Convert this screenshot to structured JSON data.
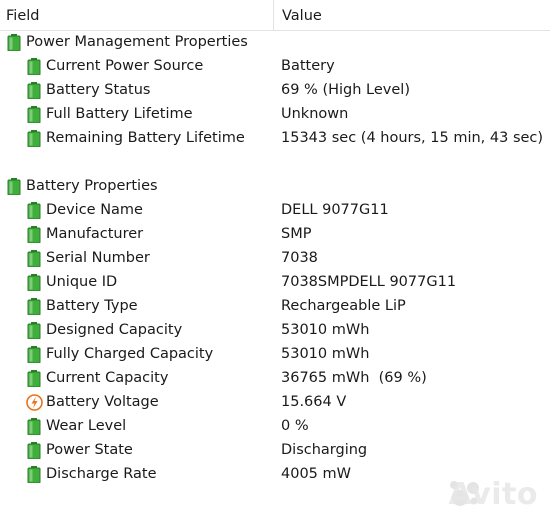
{
  "columns": {
    "field": "Field",
    "value": "Value"
  },
  "rows": [
    {
      "label": "Power Management Properties",
      "value": "",
      "icon": "battery-icon"
    },
    {
      "label": "Current Power Source",
      "value": "Battery",
      "icon": "battery-icon"
    },
    {
      "label": "Battery Status",
      "value": "69 % (High Level)",
      "icon": "battery-icon"
    },
    {
      "label": "Full Battery Lifetime",
      "value": "Unknown",
      "icon": "battery-icon"
    },
    {
      "label": "Remaining Battery Lifetime",
      "value": "15343 sec (4 hours, 15 min, 43 sec)",
      "icon": "battery-icon"
    },
    {
      "label": "Battery Properties",
      "value": "",
      "icon": "battery-icon"
    },
    {
      "label": "Device Name",
      "value": "DELL 9077G11",
      "icon": "battery-icon"
    },
    {
      "label": "Manufacturer",
      "value": "SMP",
      "icon": "battery-icon"
    },
    {
      "label": "Serial Number",
      "value": "7038",
      "icon": "battery-icon"
    },
    {
      "label": "Unique ID",
      "value": "7038SMPDELL 9077G11",
      "icon": "battery-icon"
    },
    {
      "label": "Battery Type",
      "value": "Rechargeable LiP",
      "icon": "battery-icon"
    },
    {
      "label": "Designed Capacity",
      "value": "53010 mWh",
      "icon": "battery-icon"
    },
    {
      "label": "Fully Charged Capacity",
      "value": "53010 mWh",
      "icon": "battery-icon"
    },
    {
      "label": "Current Capacity",
      "value": "36765 mWh  (69 %)",
      "icon": "battery-icon"
    },
    {
      "label": "Battery Voltage",
      "value": "15.664 V",
      "icon": "voltage-icon"
    },
    {
      "label": "Wear Level",
      "value": "0 %",
      "icon": "battery-icon"
    },
    {
      "label": "Power State",
      "value": "Discharging",
      "icon": "battery-icon"
    },
    {
      "label": "Discharge Rate",
      "value": "4005 mW",
      "icon": "battery-icon"
    }
  ],
  "watermark": "Avito",
  "colors": {
    "battery_green": "#3fae3a",
    "battery_dark": "#2a7d27",
    "voltage_orange": "#e8731a"
  }
}
